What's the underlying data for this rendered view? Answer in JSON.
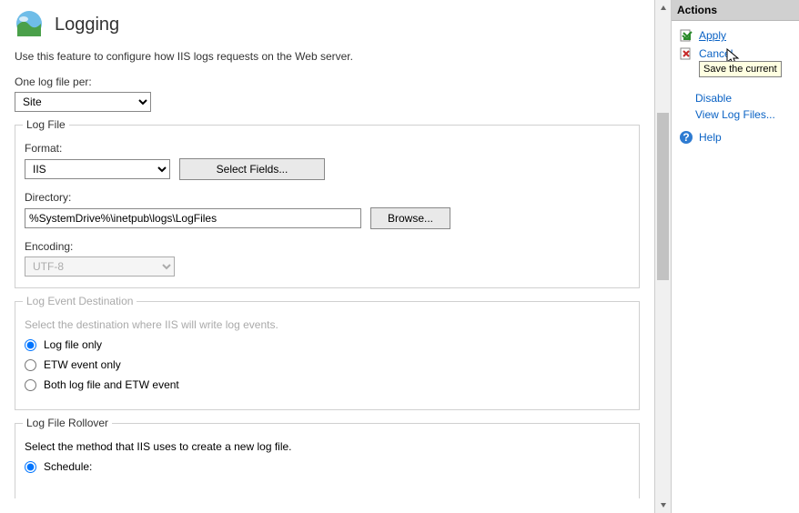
{
  "header": {
    "title": "Logging"
  },
  "description": "Use this feature to configure how IIS logs requests on the Web server.",
  "oneLogPer": {
    "label": "One log file per:",
    "value": "Site"
  },
  "logFile": {
    "title": "Log File",
    "formatLabel": "Format:",
    "formatValue": "IIS",
    "selectFieldsBtn": "Select Fields...",
    "directoryLabel": "Directory:",
    "directoryValue": "%SystemDrive%\\inetpub\\logs\\LogFiles",
    "browseBtn": "Browse...",
    "encodingLabel": "Encoding:",
    "encodingValue": "UTF-8"
  },
  "logEventDest": {
    "title": "Log Event Destination",
    "desc": "Select the destination where IIS will write log events.",
    "opt1": "Log file only",
    "opt2": "ETW event only",
    "opt3": "Both log file and ETW event"
  },
  "rollover": {
    "title": "Log File Rollover",
    "desc": "Select the method that IIS uses to create a new log file.",
    "opt1": "Schedule:"
  },
  "actions": {
    "header": "Actions",
    "apply": "Apply",
    "cancel": "Cancel",
    "disable": "Disable",
    "viewLogs": "View Log Files...",
    "help": "Help",
    "tooltip": "Save the current"
  }
}
